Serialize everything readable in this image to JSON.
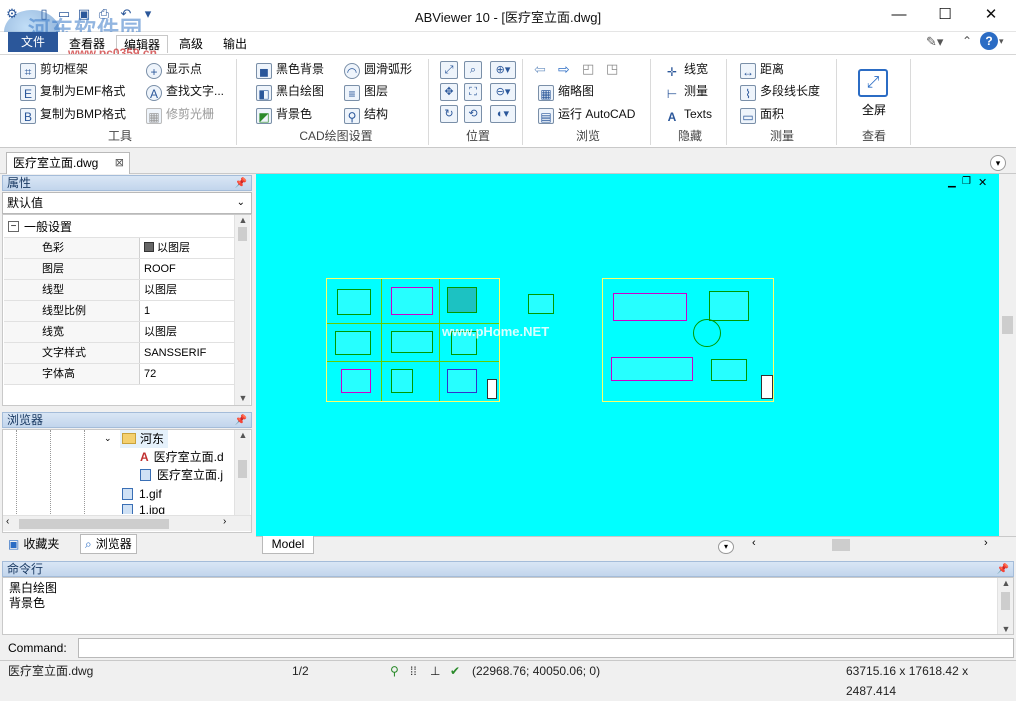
{
  "window": {
    "title": "ABViewer 10 - [医疗室立面.dwg]",
    "minimize": "—",
    "maximize": "☐",
    "close": "✕"
  },
  "watermark": {
    "text": "河东软件园",
    "url": "www.pc0359.cn"
  },
  "menu": {
    "file": "文件",
    "tabs": [
      "查看器",
      "编辑器",
      "高级",
      "输出"
    ],
    "active": "编辑器"
  },
  "ribbon": {
    "tools": {
      "items": [
        "剪切框架",
        "复制为EMF格式",
        "复制为BMP格式",
        "显示点",
        "查找文字...",
        "修剪光栅"
      ],
      "group": "工具"
    },
    "cad": {
      "items": [
        "黑色背景",
        "黑白绘图",
        "背景色",
        "圆滑弧形",
        "图层",
        "结构"
      ],
      "group": "CAD绘图设置"
    },
    "position": {
      "group": "位置"
    },
    "browse": {
      "items": [
        "缩略图",
        "运行 AutoCAD"
      ],
      "group": "浏览"
    },
    "hide": {
      "items": [
        "线宽",
        "测量",
        "Texts"
      ],
      "group": "隐藏"
    },
    "measure": {
      "items": [
        "距离",
        "多段线长度",
        "面积"
      ],
      "group": "测量"
    },
    "view": {
      "fullscreen": "全屏",
      "group": "查看"
    }
  },
  "doc_tab": {
    "label": "医疗室立面.dwg"
  },
  "properties": {
    "header": "属性",
    "dropdown": "默认值",
    "section": "一般设置",
    "rows": [
      {
        "key": "色彩",
        "value": "以图层"
      },
      {
        "key": "图层",
        "value": "ROOF"
      },
      {
        "key": "线型",
        "value": "以图层"
      },
      {
        "key": "线型比例",
        "value": "1"
      },
      {
        "key": "线宽",
        "value": "以图层"
      },
      {
        "key": "文字样式",
        "value": "SANSSERIF"
      },
      {
        "key": "字体高",
        "value": "72"
      }
    ]
  },
  "browser": {
    "header": "浏览器",
    "items": [
      {
        "label": "河东",
        "kind": "folder"
      },
      {
        "label": "医疗室立面.d",
        "kind": "dwg"
      },
      {
        "label": "医疗室立面.j",
        "kind": "img"
      },
      {
        "label": "1.gif",
        "kind": "img"
      },
      {
        "label": "1.jpg",
        "kind": "img"
      }
    ],
    "tabs": [
      "收藏夹",
      "浏览器"
    ]
  },
  "canvas": {
    "background": "#00ffff",
    "model_tab": "Model",
    "watermark": "www.pHome.NET"
  },
  "command": {
    "header": "命令行",
    "history": [
      "黑白绘图",
      "背景色"
    ],
    "prompt": "Command:"
  },
  "status": {
    "file": "医疗室立面.dwg",
    "page": "1/2",
    "coords": "(22968.76; 40050.06; 0)",
    "size": "63715.16 x 17618.42 x 2487.414"
  }
}
